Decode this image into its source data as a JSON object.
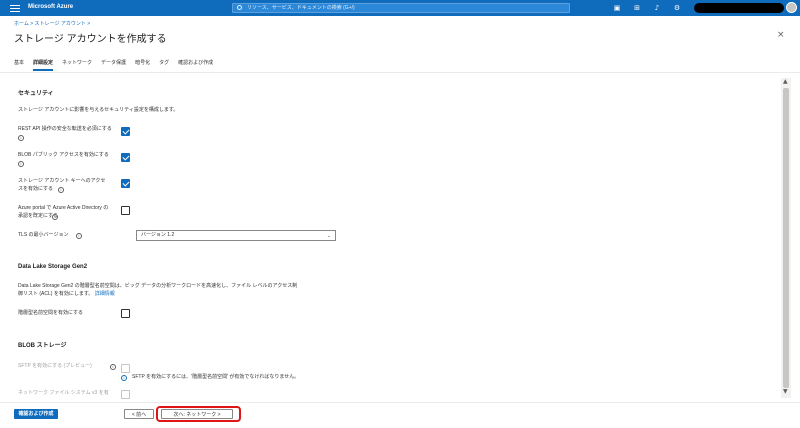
{
  "topbar": {
    "brand": "Microsoft Azure",
    "search_placeholder": "リソース、サービス、ドキュメントの検索 (G+/)",
    "icons": [
      "terminal-icon",
      "feedback-icon",
      "bell-icon",
      "gear-icon",
      "help-icon"
    ]
  },
  "header": {
    "breadcrumb": "ホーム > ストレージ アカウント >",
    "title": "ストレージ アカウントを作成する",
    "more": "···",
    "close": "×"
  },
  "tabs": [
    {
      "label": "基本"
    },
    {
      "label": "詳細設定"
    },
    {
      "label": "ネットワーク"
    },
    {
      "label": "データ保護"
    },
    {
      "label": "暗号化"
    },
    {
      "label": "タグ"
    },
    {
      "label": "確認および作成"
    }
  ],
  "security": {
    "title": "セキュリティ",
    "description": "ストレージ アカウントに影響を与えるセキュリティ設定を構成します。",
    "rest_label": "REST API 操作の安全な転送を必須にする",
    "blob_label": "BLOB パブリック アクセスを有効にする",
    "key_line1": "ストレージ アカウント キーへのアクセ",
    "key_line2": "スを有効にする",
    "aad_line1": "Azure portal で Azure Active Directory の",
    "aad_line2": "承認を既定にする",
    "tls_label": "TLS の最小バージョン",
    "tls_value": "バージョン 1.2"
  },
  "datalake": {
    "title": "Data Lake Storage Gen2",
    "desc_line1": "Data Lake Storage Gen2 の階層型名前空間は、ビッグ データの分析ワークロードを高速化し、ファイル レベルのアクセス制",
    "desc_line2": "御リスト (ACL) を有効にします。",
    "link": "詳細情報",
    "hns_label": "階層型名前空間を有効にする"
  },
  "blob": {
    "title": "BLOB ストレージ",
    "sftp_label": "SFTP を有効にする (プレビュー)",
    "sftp_note": "SFTP を有効にするには、'階層型名前空間' が有効でなければなりません。",
    "nfs_label": "ネットワーク ファイル システム v3 を有"
  },
  "footer": {
    "review_create": "確認および作成",
    "prev": "< 前へ",
    "next": "次へ: ネットワーク >"
  }
}
